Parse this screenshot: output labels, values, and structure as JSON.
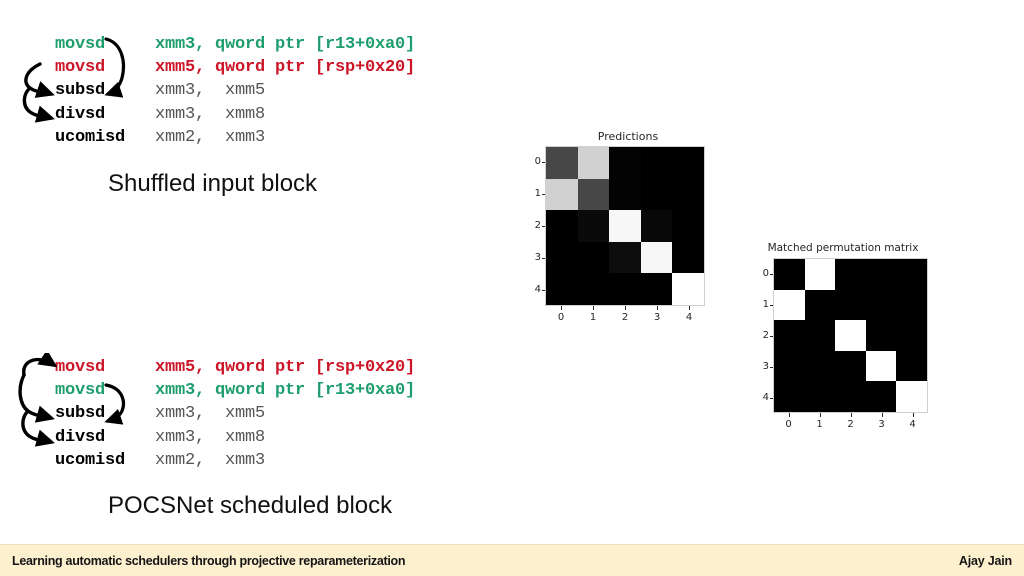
{
  "slide": {
    "background_color": "#ffffff"
  },
  "code_blocks": [
    {
      "id": "shuffled",
      "caption": "Shuffled input block",
      "lines": [
        {
          "mnemonic": "movsd",
          "operands": "xmm3, qword ptr [r13+0xa0]",
          "mnemonic_color": "#1e9e6e",
          "operand_color": "#1e9e6e",
          "operand_bold": true
        },
        {
          "mnemonic": "movsd",
          "operands": "xmm5, qword ptr [rsp+0x20]",
          "mnemonic_color": "#cc1527",
          "operand_color": "#cc1527",
          "operand_bold": true
        },
        {
          "mnemonic": "subsd",
          "operands": "xmm3,  xmm5",
          "mnemonic_color": "#000000",
          "operand_color": "#555555",
          "operand_bold": false
        },
        {
          "mnemonic": "divsd",
          "operands": "xmm3,  xmm8",
          "mnemonic_color": "#000000",
          "operand_color": "#555555",
          "operand_bold": false
        },
        {
          "mnemonic": "ucomisd",
          "operands": "xmm2,  xmm3",
          "mnemonic_color": "#000000",
          "operand_color": "#555555",
          "operand_bold": false
        }
      ]
    },
    {
      "id": "pocsnet",
      "caption": "POCSNet scheduled block",
      "lines": [
        {
          "mnemonic": "movsd",
          "operands": "xmm5, qword ptr [rsp+0x20]",
          "mnemonic_color": "#cc1527",
          "operand_color": "#cc1527",
          "operand_bold": true
        },
        {
          "mnemonic": "movsd",
          "operands": "xmm3, qword ptr [r13+0xa0]",
          "mnemonic_color": "#1e9e6e",
          "operand_color": "#1e9e6e",
          "operand_bold": true
        },
        {
          "mnemonic": "subsd",
          "operands": "xmm3,  xmm5",
          "mnemonic_color": "#000000",
          "operand_color": "#555555",
          "operand_bold": false
        },
        {
          "mnemonic": "divsd",
          "operands": "xmm3,  xmm8",
          "mnemonic_color": "#000000",
          "operand_color": "#555555",
          "operand_bold": false
        },
        {
          "mnemonic": "ucomisd",
          "operands": "xmm2,  xmm3",
          "mnemonic_color": "#000000",
          "operand_color": "#555555",
          "operand_bold": false
        }
      ]
    }
  ],
  "chart_data": [
    {
      "type": "heatmap",
      "title": "Predictions",
      "xlabel": "",
      "ylabel": "",
      "xticklabels": [
        "0",
        "1",
        "2",
        "3",
        "4"
      ],
      "yticklabels": [
        "0",
        "1",
        "2",
        "3",
        "4"
      ],
      "cmap": "gray",
      "vmin": 0,
      "vmax": 1,
      "grid": false,
      "values": [
        [
          0.28,
          0.82,
          0.01,
          0.0,
          0.0
        ],
        [
          0.82,
          0.28,
          0.01,
          0.0,
          0.0
        ],
        [
          0.0,
          0.04,
          0.97,
          0.03,
          0.0
        ],
        [
          0.0,
          0.0,
          0.05,
          0.97,
          0.0
        ],
        [
          0.0,
          0.0,
          0.0,
          0.0,
          1.0
        ]
      ]
    },
    {
      "type": "heatmap",
      "title": "Matched permutation matrix",
      "xlabel": "",
      "ylabel": "",
      "xticklabels": [
        "0",
        "1",
        "2",
        "3",
        "4"
      ],
      "yticklabels": [
        "0",
        "1",
        "2",
        "3",
        "4"
      ],
      "cmap": "gray",
      "vmin": 0,
      "vmax": 1,
      "grid": false,
      "values": [
        [
          0,
          1,
          0,
          0,
          0
        ],
        [
          1,
          0,
          0,
          0,
          0
        ],
        [
          0,
          0,
          1,
          0,
          0
        ],
        [
          0,
          0,
          0,
          1,
          0
        ],
        [
          0,
          0,
          0,
          0,
          1
        ]
      ]
    }
  ],
  "footer": {
    "title": "Learning automatic schedulers through projective reparameterization",
    "author": "Ajay Jain",
    "background_color": "#fdf0cf"
  }
}
